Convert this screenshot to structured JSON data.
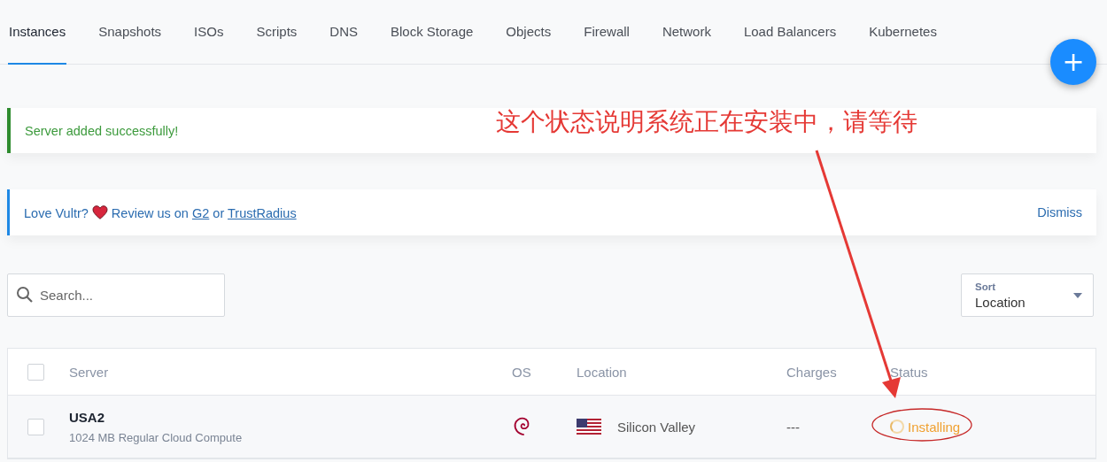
{
  "tabs": [
    {
      "label": "Instances",
      "selected": true
    },
    {
      "label": "Snapshots",
      "selected": false
    },
    {
      "label": "ISOs",
      "selected": false
    },
    {
      "label": "Scripts",
      "selected": false
    },
    {
      "label": "DNS",
      "selected": false
    },
    {
      "label": "Block Storage",
      "selected": false
    },
    {
      "label": "Objects",
      "selected": false
    },
    {
      "label": "Firewall",
      "selected": false
    },
    {
      "label": "Network",
      "selected": false
    },
    {
      "label": "Load Balancers",
      "selected": false
    },
    {
      "label": "Kubernetes",
      "selected": false
    }
  ],
  "add_button": "+",
  "alerts": [
    {
      "kind": "success",
      "text": "Server added successfully!"
    },
    {
      "kind": "info",
      "before": "Love Vultr?",
      "middle": "Review us on",
      "link_1": "G2",
      "between": "or",
      "link_2": "TrustRadius",
      "action": "Dismiss"
    }
  ],
  "search": {
    "placeholder": "Search..."
  },
  "sort": {
    "label": "Sort",
    "value": "Location"
  },
  "table": {
    "select_all": {
      "checked": false
    },
    "columns": [
      "Server",
      "OS",
      "Location",
      "Charges",
      "Status"
    ],
    "rows": [
      {
        "checked": false,
        "server": "USA2",
        "plan": "1024 MB Regular Cloud Compute",
        "location": "Silicon Valley",
        "charges": "---",
        "status": "Installing"
      }
    ]
  },
  "annotation": {
    "note": "这个状态说明系统正在安装中，请等待"
  }
}
